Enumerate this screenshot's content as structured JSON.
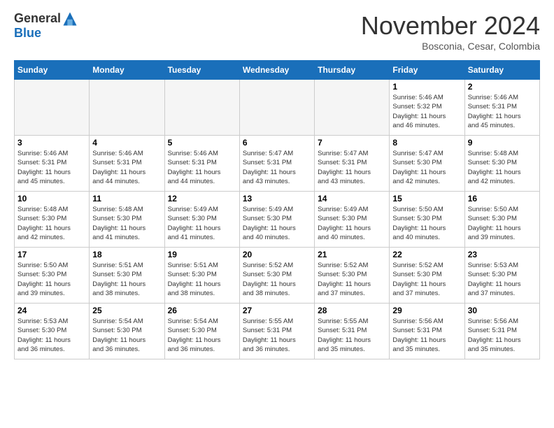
{
  "header": {
    "logo_line1": "General",
    "logo_line2": "Blue",
    "month": "November 2024",
    "location": "Bosconia, Cesar, Colombia"
  },
  "weekdays": [
    "Sunday",
    "Monday",
    "Tuesday",
    "Wednesday",
    "Thursday",
    "Friday",
    "Saturday"
  ],
  "weeks": [
    [
      {
        "day": "",
        "info": ""
      },
      {
        "day": "",
        "info": ""
      },
      {
        "day": "",
        "info": ""
      },
      {
        "day": "",
        "info": ""
      },
      {
        "day": "",
        "info": ""
      },
      {
        "day": "1",
        "info": "Sunrise: 5:46 AM\nSunset: 5:32 PM\nDaylight: 11 hours\nand 46 minutes."
      },
      {
        "day": "2",
        "info": "Sunrise: 5:46 AM\nSunset: 5:31 PM\nDaylight: 11 hours\nand 45 minutes."
      }
    ],
    [
      {
        "day": "3",
        "info": "Sunrise: 5:46 AM\nSunset: 5:31 PM\nDaylight: 11 hours\nand 45 minutes."
      },
      {
        "day": "4",
        "info": "Sunrise: 5:46 AM\nSunset: 5:31 PM\nDaylight: 11 hours\nand 44 minutes."
      },
      {
        "day": "5",
        "info": "Sunrise: 5:46 AM\nSunset: 5:31 PM\nDaylight: 11 hours\nand 44 minutes."
      },
      {
        "day": "6",
        "info": "Sunrise: 5:47 AM\nSunset: 5:31 PM\nDaylight: 11 hours\nand 43 minutes."
      },
      {
        "day": "7",
        "info": "Sunrise: 5:47 AM\nSunset: 5:31 PM\nDaylight: 11 hours\nand 43 minutes."
      },
      {
        "day": "8",
        "info": "Sunrise: 5:47 AM\nSunset: 5:30 PM\nDaylight: 11 hours\nand 42 minutes."
      },
      {
        "day": "9",
        "info": "Sunrise: 5:48 AM\nSunset: 5:30 PM\nDaylight: 11 hours\nand 42 minutes."
      }
    ],
    [
      {
        "day": "10",
        "info": "Sunrise: 5:48 AM\nSunset: 5:30 PM\nDaylight: 11 hours\nand 42 minutes."
      },
      {
        "day": "11",
        "info": "Sunrise: 5:48 AM\nSunset: 5:30 PM\nDaylight: 11 hours\nand 41 minutes."
      },
      {
        "day": "12",
        "info": "Sunrise: 5:49 AM\nSunset: 5:30 PM\nDaylight: 11 hours\nand 41 minutes."
      },
      {
        "day": "13",
        "info": "Sunrise: 5:49 AM\nSunset: 5:30 PM\nDaylight: 11 hours\nand 40 minutes."
      },
      {
        "day": "14",
        "info": "Sunrise: 5:49 AM\nSunset: 5:30 PM\nDaylight: 11 hours\nand 40 minutes."
      },
      {
        "day": "15",
        "info": "Sunrise: 5:50 AM\nSunset: 5:30 PM\nDaylight: 11 hours\nand 40 minutes."
      },
      {
        "day": "16",
        "info": "Sunrise: 5:50 AM\nSunset: 5:30 PM\nDaylight: 11 hours\nand 39 minutes."
      }
    ],
    [
      {
        "day": "17",
        "info": "Sunrise: 5:50 AM\nSunset: 5:30 PM\nDaylight: 11 hours\nand 39 minutes."
      },
      {
        "day": "18",
        "info": "Sunrise: 5:51 AM\nSunset: 5:30 PM\nDaylight: 11 hours\nand 38 minutes."
      },
      {
        "day": "19",
        "info": "Sunrise: 5:51 AM\nSunset: 5:30 PM\nDaylight: 11 hours\nand 38 minutes."
      },
      {
        "day": "20",
        "info": "Sunrise: 5:52 AM\nSunset: 5:30 PM\nDaylight: 11 hours\nand 38 minutes."
      },
      {
        "day": "21",
        "info": "Sunrise: 5:52 AM\nSunset: 5:30 PM\nDaylight: 11 hours\nand 37 minutes."
      },
      {
        "day": "22",
        "info": "Sunrise: 5:52 AM\nSunset: 5:30 PM\nDaylight: 11 hours\nand 37 minutes."
      },
      {
        "day": "23",
        "info": "Sunrise: 5:53 AM\nSunset: 5:30 PM\nDaylight: 11 hours\nand 37 minutes."
      }
    ],
    [
      {
        "day": "24",
        "info": "Sunrise: 5:53 AM\nSunset: 5:30 PM\nDaylight: 11 hours\nand 36 minutes."
      },
      {
        "day": "25",
        "info": "Sunrise: 5:54 AM\nSunset: 5:30 PM\nDaylight: 11 hours\nand 36 minutes."
      },
      {
        "day": "26",
        "info": "Sunrise: 5:54 AM\nSunset: 5:30 PM\nDaylight: 11 hours\nand 36 minutes."
      },
      {
        "day": "27",
        "info": "Sunrise: 5:55 AM\nSunset: 5:31 PM\nDaylight: 11 hours\nand 36 minutes."
      },
      {
        "day": "28",
        "info": "Sunrise: 5:55 AM\nSunset: 5:31 PM\nDaylight: 11 hours\nand 35 minutes."
      },
      {
        "day": "29",
        "info": "Sunrise: 5:56 AM\nSunset: 5:31 PM\nDaylight: 11 hours\nand 35 minutes."
      },
      {
        "day": "30",
        "info": "Sunrise: 5:56 AM\nSunset: 5:31 PM\nDaylight: 11 hours\nand 35 minutes."
      }
    ]
  ]
}
